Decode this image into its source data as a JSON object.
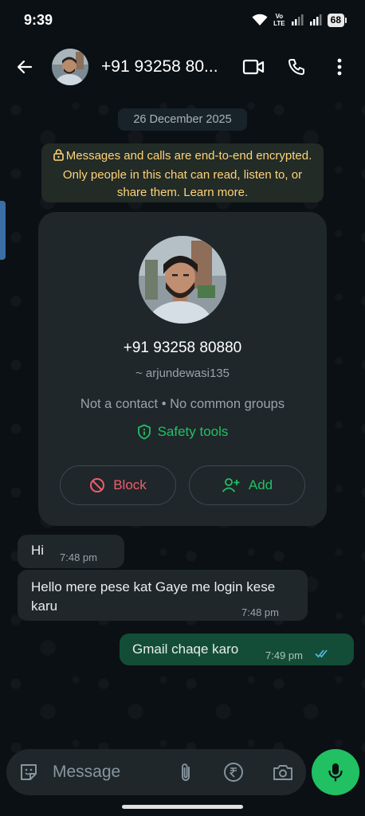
{
  "status_bar": {
    "time": "9:39",
    "volte_top": "Vo",
    "volte_bottom": "LTE",
    "battery": "68"
  },
  "header": {
    "contact_name": "+91 93258 80..."
  },
  "chat": {
    "date_chip": "26 December 2025",
    "encryption_notice": "Messages and calls are end-to-end encrypted. Only people in this chat can read, listen to, or share them. Learn more."
  },
  "contact_card": {
    "phone": "+91 93258 80880",
    "username": "~ arjundewasi135",
    "meta": "Not a contact • No common groups",
    "safety_tools": "Safety tools",
    "block_label": "Block",
    "add_label": "Add"
  },
  "messages": [
    {
      "direction": "incoming",
      "text": "Hi",
      "time": "7:48 pm"
    },
    {
      "direction": "incoming",
      "text": "Hello mere pese kat Gaye me login kese karu",
      "time": "7:48 pm"
    },
    {
      "direction": "outgoing",
      "text": "Gmail chaqe karo",
      "time": "7:49 pm",
      "status": "read"
    }
  ],
  "composer": {
    "placeholder": "Message"
  },
  "colors": {
    "accent_green": "#21c063",
    "outgoing_bubble": "#144d37",
    "incoming_bubble": "#1f272a",
    "block_red": "#f15c6d",
    "notice_yellow": "#ffd279",
    "read_ticks": "#53bdeb"
  },
  "icons": [
    "back-arrow-icon",
    "video-call-icon",
    "phone-icon",
    "more-options-icon",
    "lock-icon",
    "shield-icon",
    "block-icon",
    "add-person-icon",
    "double-check-icon",
    "sticker-icon",
    "attach-icon",
    "rupee-icon",
    "camera-icon",
    "mic-icon"
  ]
}
